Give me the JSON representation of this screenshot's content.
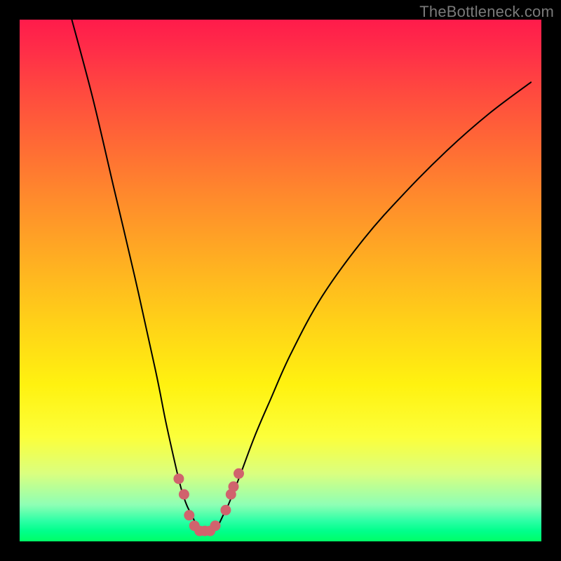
{
  "watermark": {
    "text": "TheBottleneck.com"
  },
  "chart_data": {
    "type": "line",
    "title": "",
    "xlabel": "",
    "ylabel": "",
    "xlim": [
      0,
      100
    ],
    "ylim": [
      0,
      100
    ],
    "grid": false,
    "series": [
      {
        "name": "bottleneck-curve",
        "x": [
          10,
          14,
          18,
          22,
          26,
          28,
          30,
          31,
          32,
          33,
          34,
          35,
          36,
          37,
          38,
          39,
          40,
          42,
          45,
          48,
          52,
          58,
          66,
          74,
          82,
          90,
          98
        ],
        "y": [
          100,
          85,
          68,
          51,
          33,
          23,
          14,
          10,
          7,
          5,
          3,
          2,
          2,
          2,
          3,
          5,
          7,
          12,
          20,
          27,
          36,
          47,
          58,
          67,
          75,
          82,
          88
        ]
      }
    ],
    "markers": {
      "name": "highlight-zone",
      "color": "#d0636d",
      "points": [
        {
          "x": 30.5,
          "y": 12
        },
        {
          "x": 31.5,
          "y": 9
        },
        {
          "x": 32.5,
          "y": 5
        },
        {
          "x": 33.5,
          "y": 3
        },
        {
          "x": 34.5,
          "y": 2
        },
        {
          "x": 35.5,
          "y": 2
        },
        {
          "x": 36.5,
          "y": 2
        },
        {
          "x": 37.5,
          "y": 3
        },
        {
          "x": 39.5,
          "y": 6
        },
        {
          "x": 40.5,
          "y": 9
        },
        {
          "x": 41.0,
          "y": 10.5
        },
        {
          "x": 42.0,
          "y": 13
        }
      ]
    }
  }
}
